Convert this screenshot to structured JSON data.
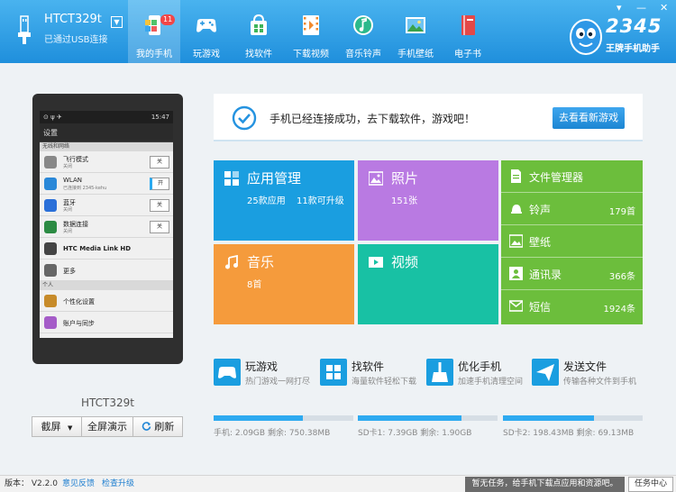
{
  "device": {
    "name": "HTCT329t",
    "connection": "已通过USB连接",
    "dropdown_glyph": "▼"
  },
  "nav": {
    "items": [
      {
        "label": "我的手机",
        "icon": "my-phone-icon",
        "badge": "11",
        "active": true
      },
      {
        "label": "玩游戏",
        "icon": "gamepad-icon"
      },
      {
        "label": "找软件",
        "icon": "software-bag-icon"
      },
      {
        "label": "下载视频",
        "icon": "film-icon"
      },
      {
        "label": "音乐铃声",
        "icon": "music-note-icon"
      },
      {
        "label": "手机壁纸",
        "icon": "wallpaper-icon"
      },
      {
        "label": "电子书",
        "icon": "ebook-icon"
      }
    ]
  },
  "window": {
    "menu_glyph": "▾",
    "minimize_glyph": "—",
    "close_glyph": "✕"
  },
  "brand": {
    "number": "2345",
    "tagline": "王牌手机助手"
  },
  "phone_screen": {
    "status_icons": "⊙ ψ ✈",
    "status_time": "15:47",
    "title": "设置",
    "section1": "无线和网络",
    "rows": [
      {
        "title": "飞行模式",
        "sub": "关闭",
        "toggle": "关",
        "icon": "airplane-icon",
        "color": "#888888"
      },
      {
        "title": "WLAN",
        "sub": "已连接到 2345-kehu",
        "toggle": "开",
        "icon": "wifi-icon",
        "color": "#2a88d8"
      },
      {
        "title": "蓝牙",
        "sub": "关闭",
        "toggle": "关",
        "icon": "bluetooth-icon",
        "color": "#2a6fd8"
      },
      {
        "title": "数据连接",
        "sub": "关闭",
        "toggle": "关",
        "icon": "globe-icon",
        "color": "#2c8b43"
      },
      {
        "title": "HTC Media Link HD",
        "sub": "",
        "toggle": "",
        "icon": "media-link-icon",
        "color": "#444444"
      },
      {
        "title": "更多",
        "sub": "",
        "toggle": "",
        "icon": "more-icon",
        "color": "#666666"
      }
    ],
    "section2": "个人",
    "rows2": [
      {
        "title": "个性化设置",
        "icon": "brush-icon",
        "color": "#c78b2a"
      },
      {
        "title": "账户与同步",
        "icon": "sync-icon",
        "color": "#a55cc8"
      }
    ]
  },
  "phone_model_label": "HTCT329t",
  "phone_buttons": {
    "screenshot": "截屏",
    "screenshot_arrow": "▼",
    "fullscreen": "全屏演示",
    "refresh": "刷新"
  },
  "status": {
    "message": "手机已经连接成功，去下载软件，游戏吧！",
    "button": "去看看新游戏"
  },
  "tiles": {
    "apps": {
      "title": "应用管理",
      "sub": "25款应用",
      "sub2": "11款可升级"
    },
    "photo": {
      "title": "照片",
      "sub": "151张"
    },
    "music": {
      "title": "音乐",
      "sub": "8首"
    },
    "video": {
      "title": "视频"
    },
    "files": [
      {
        "label": "文件管理器",
        "count": ""
      },
      {
        "label": "铃声",
        "count": "179首"
      },
      {
        "label": "壁纸",
        "count": ""
      },
      {
        "label": "通讯录",
        "count": "366条"
      },
      {
        "label": "短信",
        "count": "1924条"
      }
    ]
  },
  "quick": [
    {
      "title": "玩游戏",
      "sub": "热门游戏一网打尽",
      "color": "#1a9ee0"
    },
    {
      "title": "找软件",
      "sub": "海量软件轻松下载",
      "color": "#1a9ee0"
    },
    {
      "title": "优化手机",
      "sub": "加速手机清理空间",
      "color": "#1a9ee0"
    },
    {
      "title": "发送文件",
      "sub": "传输各种文件到手机",
      "color": "#1a9ee0"
    }
  ],
  "storage": [
    {
      "text": "手机: 2.09GB  剩余: 750.38MB",
      "used_fraction": 0.64
    },
    {
      "text": "SD卡1: 7.39GB  剩余: 1.90GB",
      "used_fraction": 0.74
    },
    {
      "text": "SD卡2: 198.43MB  剩余: 69.13MB",
      "used_fraction": 0.65
    }
  ],
  "footer": {
    "version": "版本：  V2.2.0",
    "feedback": "意见反馈",
    "update": "检查升级",
    "task_message": "暂无任务，给手机下载点应用和资源吧。",
    "task_center": "任务中心"
  }
}
